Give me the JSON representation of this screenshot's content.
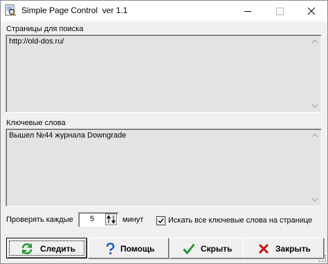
{
  "window": {
    "title": "Simple Page Control  ver 1.1"
  },
  "pages": {
    "label": "Страницы для поиска",
    "value": "http://old-dos.ru/"
  },
  "keywords": {
    "label": "Ключевые слова",
    "value": "Вышел №44 журнала Downgrade"
  },
  "interval": {
    "label_before": "Проверять каждые",
    "value": "5",
    "label_after": "минут"
  },
  "search_all": {
    "label": "Искать все ключевые слова на странице",
    "checked": true
  },
  "buttons": {
    "track": "Следить",
    "help": "Помощь",
    "hide": "Скрыть",
    "close": "Закрыть"
  },
  "icons": {
    "app": "app-icon",
    "minimize": "minimize-icon",
    "maximize": "maximize-icon",
    "close": "close-icon",
    "track": "refresh-icon",
    "help": "question-icon",
    "hide": "checkmark-icon",
    "close_btn": "x-icon"
  },
  "colors": {
    "memo_background": "#e3e3e3",
    "track_icon": "#1e9a2e",
    "help_icon": "#1b5fc4",
    "hide_icon": "#1e9a2e",
    "close_icon": "#c01515"
  }
}
